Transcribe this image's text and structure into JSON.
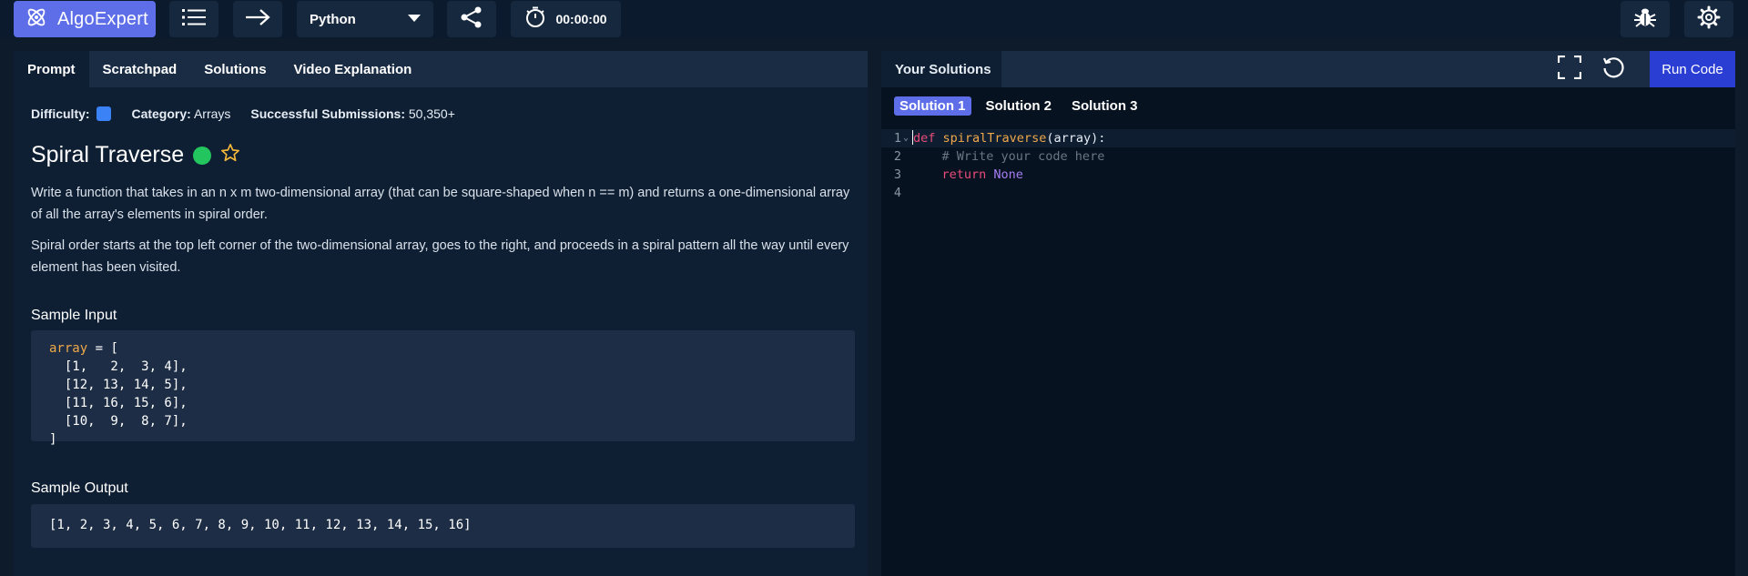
{
  "topbar": {
    "logo_text": "AlgoExpert",
    "language": "Python",
    "timer": "00:00:00"
  },
  "left": {
    "tabs": [
      "Prompt",
      "Scratchpad",
      "Solutions",
      "Video Explanation"
    ],
    "difficulty_label": "Difficulty:",
    "category_label": "Category:",
    "category_value": "Arrays",
    "submissions_label": "Successful Submissions:",
    "submissions_value": "50,350+",
    "title": "Spiral Traverse",
    "para1": "Write a function that takes in an n x m two-dimensional array (that can be square-shaped when n == m) and returns a one-dimensional array of all the array's elements in spiral order.",
    "para2": "Spiral order starts at the top left corner of the two-dimensional array, goes to the right, and proceeds in a spiral pattern all the way until every element has been visited.",
    "sample_input_label": "Sample Input",
    "sample_input_var": "array",
    "sample_input_rest": " = [",
    "sample_input_lines": [
      "  [1,   2,  3, 4],",
      "  [12, 13, 14, 5],",
      "  [11, 16, 15, 6],",
      "  [10,  9,  8, 7],",
      "]"
    ],
    "sample_output_label": "Sample Output",
    "sample_output": "[1, 2, 3, 4, 5, 6, 7, 8, 9, 10, 11, 12, 13, 14, 15, 16]"
  },
  "right": {
    "tab": "Your Solutions",
    "run_label": "Run Code",
    "solution_tabs": [
      "Solution 1",
      "Solution 2",
      "Solution 3"
    ],
    "code": {
      "line_numbers": [
        "1",
        "2",
        "3",
        "4"
      ],
      "l1_def": "def",
      "l1_fn": "spiralTraverse",
      "l1_rest": "(array):",
      "l2_comment": "    # Write your code here",
      "l3_return": "    return",
      "l3_none": "None"
    }
  }
}
